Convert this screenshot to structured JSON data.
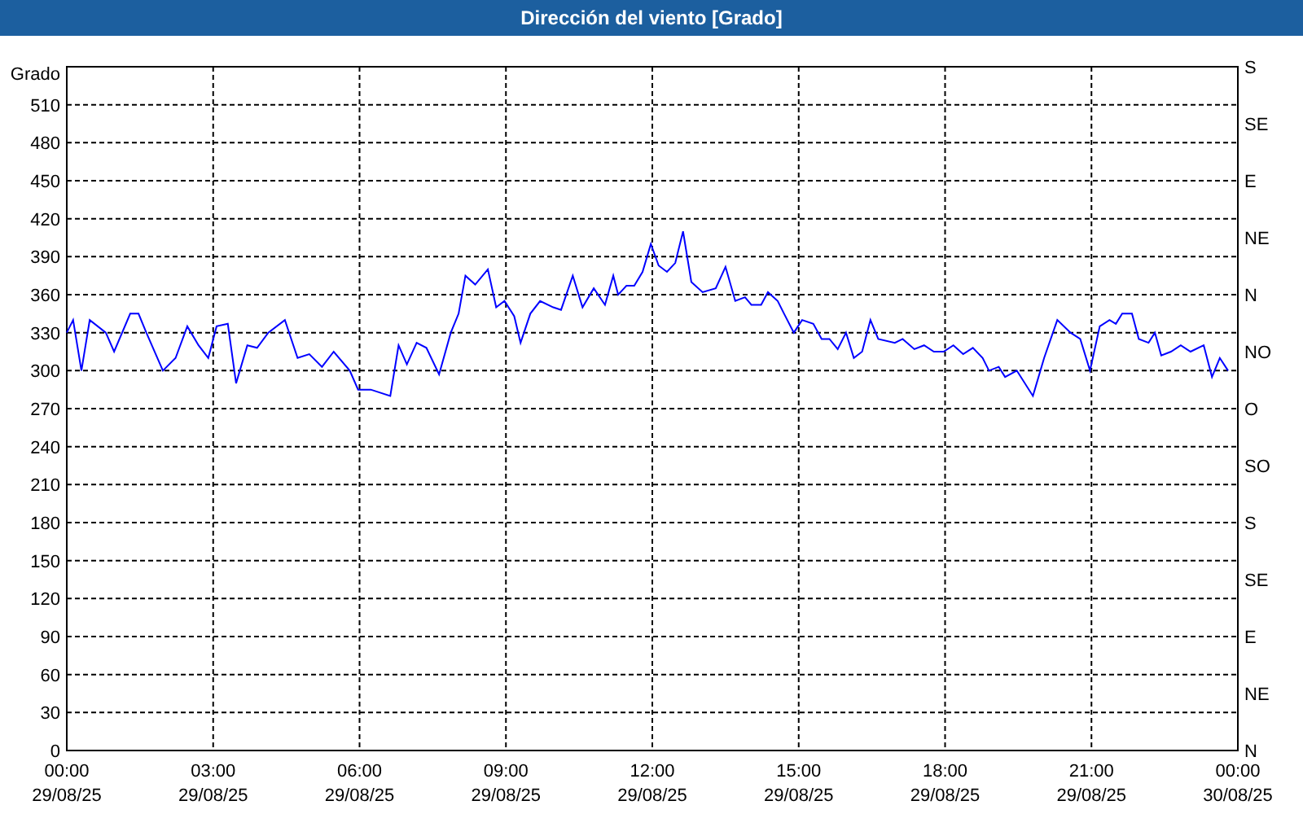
{
  "window": {
    "title": "Dirección del viento [Grado]"
  },
  "chart": {
    "chart_data": {
      "type": "line",
      "grid": true,
      "ylabel": "Grado",
      "xlim": [
        0,
        24
      ],
      "ylim": [
        0,
        540
      ],
      "yticks": [
        0,
        30,
        60,
        90,
        120,
        150,
        180,
        210,
        240,
        270,
        300,
        330,
        360,
        390,
        420,
        450,
        480,
        510
      ],
      "xticks": [
        {
          "value": 0,
          "label": "00:00"
        },
        {
          "value": 3,
          "label": "03:00"
        },
        {
          "value": 6,
          "label": "06:00"
        },
        {
          "value": 9,
          "label": "09:00"
        },
        {
          "value": 12,
          "label": "12:00"
        },
        {
          "value": 15,
          "label": "15:00"
        },
        {
          "value": 18,
          "label": "18:00"
        },
        {
          "value": 21,
          "label": "21:00"
        },
        {
          "value": 24,
          "label": "00:00"
        }
      ],
      "x": [
        0,
        0.13,
        0.3,
        0.47,
        0.8,
        0.97,
        1.3,
        1.47,
        1.63,
        1.97,
        2.23,
        2.47,
        2.7,
        2.9,
        3.07,
        3.3,
        3.47,
        3.7,
        3.9,
        4.13,
        4.47,
        4.73,
        4.97,
        5.23,
        5.47,
        5.8,
        5.97,
        6.23,
        6.63,
        6.8,
        6.97,
        7.17,
        7.37,
        7.63,
        7.87,
        8.03,
        8.17,
        8.37,
        8.63,
        8.8,
        8.97,
        9.17,
        9.3,
        9.5,
        9.7,
        9.97,
        10.13,
        10.37,
        10.57,
        10.8,
        11.03,
        11.2,
        11.3,
        11.47,
        11.63,
        11.8,
        11.97,
        12.13,
        12.3,
        12.47,
        12.63,
        12.8,
        13.03,
        13.3,
        13.5,
        13.7,
        13.9,
        14.03,
        14.23,
        14.37,
        14.57,
        14.7,
        14.9,
        15.07,
        15.3,
        15.47,
        15.63,
        15.8,
        15.97,
        16.13,
        16.3,
        16.47,
        16.63,
        16.97,
        17.13,
        17.37,
        17.57,
        17.77,
        17.97,
        18.17,
        18.37,
        18.57,
        18.77,
        18.9,
        19.1,
        19.23,
        19.47,
        19.8,
        20.03,
        20.3,
        20.57,
        20.77,
        20.97,
        21.17,
        21.37,
        21.5,
        21.63,
        21.83,
        21.97,
        22.17,
        22.3,
        22.43,
        22.63,
        22.83,
        23.03,
        23.3,
        23.47,
        23.63,
        23.8
      ],
      "series": [
        {
          "color": "#0000ff",
          "values": [
            330,
            340,
            300,
            340,
            330,
            315,
            345,
            345,
            330,
            300,
            310,
            335,
            320,
            310,
            335,
            337,
            290,
            320,
            318,
            330,
            340,
            310,
            313,
            303,
            315,
            300,
            285,
            285,
            280,
            320,
            305,
            322,
            318,
            297,
            330,
            345,
            375,
            368,
            380,
            350,
            355,
            343,
            322,
            345,
            355,
            350,
            348,
            375,
            350,
            365,
            352,
            375,
            360,
            367,
            367,
            378,
            400,
            383,
            378,
            385,
            410,
            370,
            362,
            365,
            382,
            355,
            358,
            352,
            352,
            362,
            355,
            345,
            330,
            340,
            337,
            325,
            325,
            317,
            330,
            310,
            315,
            340,
            325,
            322,
            325,
            317,
            320,
            315,
            315,
            320,
            313,
            318,
            310,
            300,
            303,
            295,
            300,
            280,
            310,
            340,
            330,
            325,
            300,
            335,
            340,
            337,
            345,
            345,
            325,
            322,
            330,
            312,
            315,
            320,
            315,
            320,
            295,
            310,
            300
          ]
        }
      ]
    },
    "x_dates": [
      "29/08/25",
      "29/08/25",
      "29/08/25",
      "29/08/25",
      "29/08/25",
      "29/08/25",
      "29/08/25",
      "29/08/25",
      "30/08/25"
    ],
    "right_axis": [
      "S",
      "SE",
      "E",
      "NE",
      "N",
      "NO",
      "O",
      "SO",
      "S",
      "SE",
      "E",
      "NE",
      "N"
    ]
  }
}
